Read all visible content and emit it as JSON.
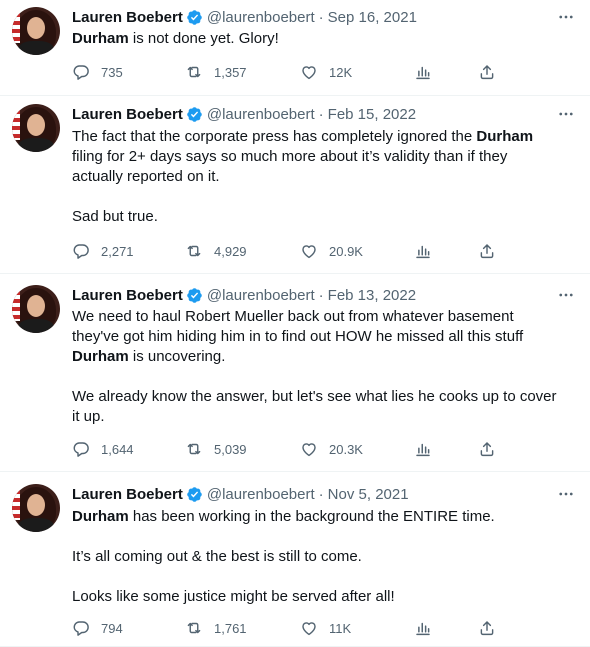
{
  "tweets": [
    {
      "name": "Lauren Boebert",
      "handle": "@laurenboebert",
      "separator": "·",
      "date": "Sep 16, 2021",
      "text_lines": [
        [
          {
            "bold": "Durham"
          },
          {
            "plain": " is not done yet. Glory!"
          }
        ]
      ],
      "replies": "735",
      "retweets": "1,357",
      "likes": "12K"
    },
    {
      "name": "Lauren Boebert",
      "handle": "@laurenboebert",
      "separator": "·",
      "date": "Feb 15, 2022",
      "text_lines": [
        [
          {
            "plain": "The fact that the corporate press has completely ignored the "
          },
          {
            "bold": "Durham"
          }
        ],
        [
          {
            "plain": "filing for 2+ days says so much more about it’s validity than if they"
          }
        ],
        [
          {
            "plain": "actually reported on it."
          }
        ],
        [],
        [
          {
            "plain": "Sad but true."
          }
        ]
      ],
      "replies": "2,271",
      "retweets": "4,929",
      "likes": "20.9K"
    },
    {
      "name": "Lauren Boebert",
      "handle": "@laurenboebert",
      "separator": "·",
      "date": "Feb 13, 2022",
      "text_lines": [
        [
          {
            "plain": "We need to haul Robert Mueller back out from whatever basement"
          }
        ],
        [
          {
            "plain": "they've got him hiding him in to find out HOW he missed all this stuff"
          }
        ],
        [
          {
            "bold": "Durham"
          },
          {
            "plain": " is uncovering."
          }
        ],
        [],
        [
          {
            "plain": "We already know the answer, but let's see what lies he cooks up to cover"
          }
        ],
        [
          {
            "plain": "it up."
          }
        ]
      ],
      "replies": "1,644",
      "retweets": "5,039",
      "likes": "20.3K"
    },
    {
      "name": "Lauren Boebert",
      "handle": "@laurenboebert",
      "separator": "·",
      "date": "Nov 5, 2021",
      "text_lines": [
        [
          {
            "bold": "Durham"
          },
          {
            "plain": " has been working in the background the ENTIRE time."
          }
        ],
        [],
        [
          {
            "plain": "It’s all coming out & the best is still to come."
          }
        ],
        [],
        [
          {
            "plain": "Looks like some justice might be served after all!"
          }
        ]
      ],
      "replies": "794",
      "retweets": "1,761",
      "likes": "11K"
    }
  ],
  "colors": {
    "verified": "#1d9bf0",
    "muted": "#536471",
    "text": "#0f1419",
    "divider": "#eff3f4"
  },
  "icons": {
    "reply": "reply-icon",
    "retweet": "retweet-icon",
    "like": "like-icon",
    "views": "views-icon",
    "share": "share-icon",
    "more": "more-icon",
    "verified": "verified-badge-icon"
  }
}
